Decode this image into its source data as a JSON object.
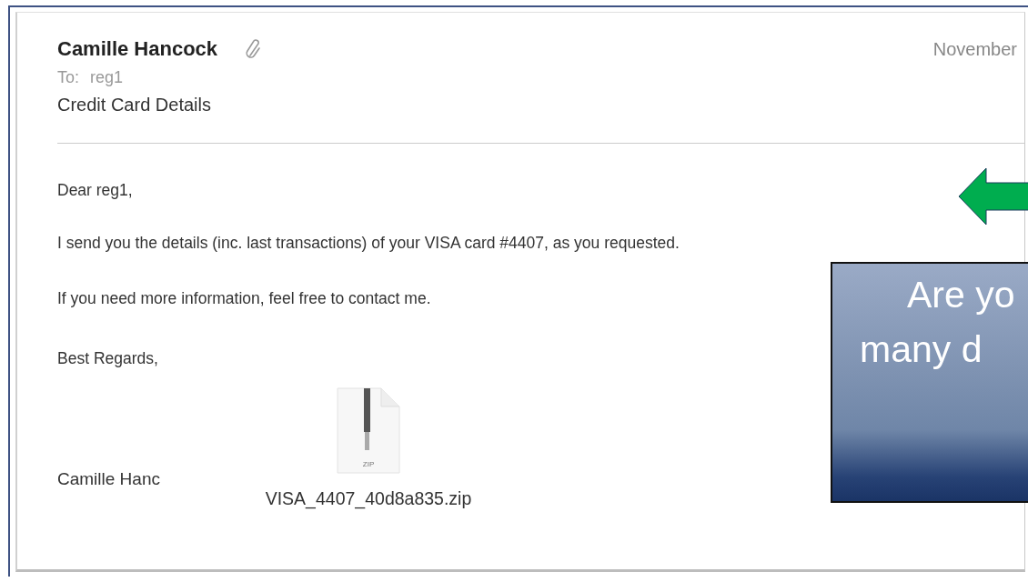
{
  "email": {
    "sender": "Camille Hancock",
    "to_label": "To:",
    "to": "reg1",
    "subject": "Credit Card Details",
    "date": "November",
    "body": [
      "Dear reg1,",
      "I send you the details (inc. last transactions) of your VISA card #4407, as you requested.",
      "If you need more information, feel free to contact me.",
      "Best Regards,"
    ],
    "footer_sender": "Camille Hanc",
    "attachment": {
      "type_label": "ZIP",
      "file_name": "VISA_4407_40d8a835.zip"
    }
  },
  "callout": {
    "lines": [
      "Are yo",
      "many d"
    ]
  }
}
